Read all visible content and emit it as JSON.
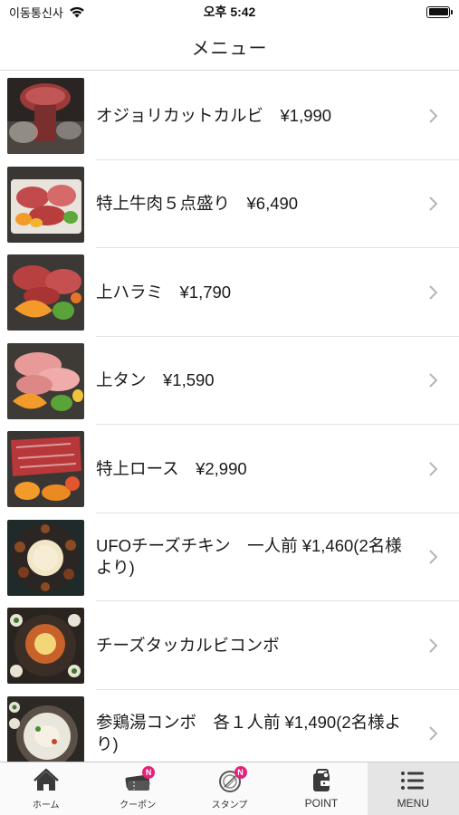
{
  "status_bar": {
    "carrier": "이동통신사",
    "time": "오후 5:42"
  },
  "header": {
    "title": "メニュー"
  },
  "menu_items": [
    {
      "label": "オジョリカットカルビ　¥1,990",
      "image": "grilled-beef-photo"
    },
    {
      "label": "特上牛肉５点盛り　¥6,490",
      "image": "beef-platter-photo"
    },
    {
      "label": "上ハラミ　¥1,790",
      "image": "harami-photo"
    },
    {
      "label": "上タン　¥1,590",
      "image": "tongue-photo"
    },
    {
      "label": "特上ロース　¥2,990",
      "image": "loin-photo"
    },
    {
      "label": "UFOチーズチキン　一人前 ¥1,460(2名様より)",
      "image": "cheese-chicken-photo"
    },
    {
      "label": "チーズタッカルビコンボ",
      "image": "dakgalbi-photo"
    },
    {
      "label": "参鶏湯コンボ　各１人前 ¥1,490(2名様より)",
      "image": "samgyetang-photo"
    }
  ],
  "tab_bar": {
    "tabs": [
      {
        "label": "ホーム",
        "icon": "home-icon"
      },
      {
        "label": "クーポン",
        "icon": "coupon-icon",
        "badge": "N"
      },
      {
        "label": "スタンプ",
        "icon": "stamp-icon",
        "badge": "N"
      },
      {
        "label": "POINT",
        "icon": "wallet-icon"
      },
      {
        "label": "MENU",
        "icon": "menu-icon"
      }
    ]
  },
  "colors": {
    "badge": "#e3217b",
    "active_tab_bg": "#e5e5e5"
  }
}
